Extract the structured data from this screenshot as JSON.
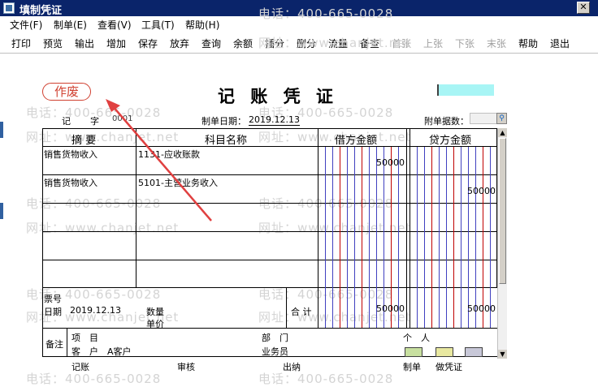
{
  "window": {
    "title": "填制凭证",
    "close_glyph": "✕"
  },
  "menu": [
    "文件(F)",
    "制单(E)",
    "查看(V)",
    "工具(T)",
    "帮助(H)"
  ],
  "toolbar": {
    "enabled": [
      "打印",
      "预览",
      "输出",
      "增加",
      "保存",
      "放弃",
      "查询",
      "余额",
      "插分",
      "删分",
      "流量",
      "备查"
    ],
    "disabled": [
      "首张",
      "上张",
      "下张",
      "末张"
    ],
    "tail": [
      "帮助",
      "退出"
    ]
  },
  "watermark": {
    "phone": "电话：400-665-0028",
    "site": "网址：www.chanjet.net"
  },
  "voucher": {
    "stamp": "作废",
    "title": "记 账 凭 证",
    "type_label": "记",
    "word_label": "字",
    "number": "0001",
    "date_label": "制单日期：",
    "date": "2019.12.13",
    "attachments_label": "附单据数："
  },
  "table": {
    "headers": {
      "summary": "摘 要",
      "account": "科目名称",
      "debit": "借方金额",
      "credit": "贷方金额"
    },
    "rows": [
      {
        "summary": "销售货物收入",
        "account": "1131-应收账款",
        "debit": "50000",
        "credit": ""
      },
      {
        "summary": "销售货物收入",
        "account": "5101-主营业务收入",
        "debit": "",
        "credit": "50000"
      },
      {
        "summary": "",
        "account": "",
        "debit": "",
        "credit": ""
      },
      {
        "summary": "",
        "account": "",
        "debit": "",
        "credit": ""
      },
      {
        "summary": "",
        "account": "",
        "debit": "",
        "credit": ""
      }
    ],
    "footer": {
      "ticket_label": "票号",
      "date_label": "日期",
      "date": "2019.12.13",
      "qty_label": "数量",
      "price_label": "单价",
      "total_label": "合 计",
      "total_debit": "50000",
      "total_credit": "50000"
    },
    "notes": {
      "label": "备注",
      "project_label": "项　目",
      "dept_label": "部　门",
      "person_label": "个　人",
      "customer_label": "客　户",
      "customer": "A客户",
      "salesman_label": "业务员"
    }
  },
  "signatures": [
    "记账",
    "审核",
    "出纳",
    "制单",
    "做凭证"
  ],
  "colors": {
    "stamp": "#d04030",
    "title_bar": "#0a246a",
    "cyan_box": "#a8f5f5",
    "grid_blue": "#4040c0",
    "grid_red": "#c00000"
  }
}
